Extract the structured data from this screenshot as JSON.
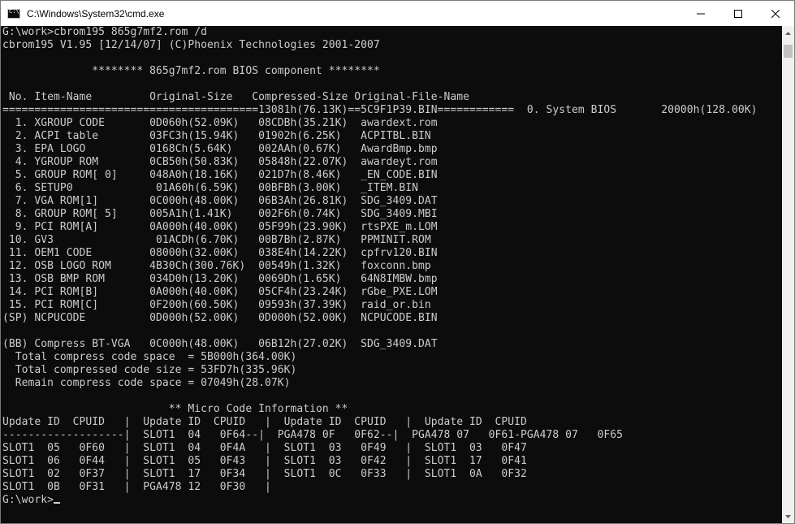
{
  "window": {
    "title": "C:\\Windows\\System32\\cmd.exe",
    "controls": {
      "minimize_icon": "minimize-icon",
      "maximize_icon": "maximize-icon",
      "close_icon": "close-icon"
    },
    "colors": {
      "console_bg": "#0c0c0c",
      "console_fg": "#cccccc",
      "titlebar_bg": "#ffffff"
    }
  },
  "console": {
    "lines": [
      "G:\\work>cbrom195 865g7mf2.rom /d",
      "cbrom195 V1.95 [12/14/07] (C)Phoenix Technologies 2001-2007",
      "",
      "              ******** 865g7mf2.rom BIOS component ********",
      "",
      " No. Item-Name         Original-Size   Compressed-Size Original-File-Name",
      "========================================13081h(76.13K)==5C9F1P39.BIN============  0. System BIOS       20000h(128.00K)",
      "  1. XGROUP CODE       0D060h(52.09K)   08CDBh(35.21K)  awardext.rom",
      "  2. ACPI table        03FC3h(15.94K)   01902h(6.25K)   ACPITBL.BIN",
      "  3. EPA LOGO          0168Ch(5.64K)    002AAh(0.67K)   AwardBmp.bmp",
      "  4. YGROUP ROM        0CB50h(50.83K)   05848h(22.07K)  awardeyt.rom",
      "  5. GROUP ROM[ 0]     048A0h(18.16K)   021D7h(8.46K)   _EN_CODE.BIN",
      "  6. SETUP0             01A60h(6.59K)   00BFBh(3.00K)   _ITEM.BIN",
      "  7. VGA ROM[1]        0C000h(48.00K)   06B3Ah(26.81K)  SDG_3409.DAT",
      "  8. GROUP ROM[ 5]     005A1h(1.41K)    002F6h(0.74K)   SDG_3409.MBI",
      "  9. PCI ROM[A]        0A000h(40.00K)   05F99h(23.90K)  rtsPXE_m.LOM",
      " 10. GV3                01ACDh(6.70K)   00B7Bh(2.87K)   PPMINIT.ROM",
      " 11. OEM1 CODE         08000h(32.00K)   038E4h(14.22K)  cpfrv120.BIN",
      " 12. OSB LOGO ROM      4B30Ch(300.76K)  00549h(1.32K)   foxconn.bmp",
      " 13. OSB BMP ROM       034D0h(13.20K)   0069Dh(1.65K)   64N8IMBW.bmp",
      " 14. PCI ROM[B]        0A000h(40.00K)   05CF4h(23.24K)  rGbe_PXE.LOM",
      " 15. PCI ROM[C]        0F200h(60.50K)   09593h(37.39K)  raid_or.bin",
      "(SP) NCPUCODE          0D000h(52.00K)   0D000h(52.00K)  NCPUCODE.BIN",
      "",
      "(BB) Compress BT-VGA   0C000h(48.00K)   06B12h(27.02K)  SDG_3409.DAT",
      "  Total compress code space  = 5B000h(364.00K)",
      "  Total compressed code size = 53FD7h(335.96K)",
      "  Remain compress code space = 07049h(28.07K)",
      "",
      "                          ** Micro Code Information **",
      "Update ID  CPUID   |  Update ID  CPUID   |  Update ID  CPUID   |  Update ID  CPUID",
      "-------------------|  SLOT1  04   0F64--|  PGA478 0F   0F62--|  PGA478 07   0F61-PGA478 07   0F65",
      "SLOT1  05   0F60   |  SLOT1  04   0F4A   |  SLOT1  03   0F49   |  SLOT1  03   0F47",
      "SLOT1  06   0F44   |  SLOT1  05   0F43   |  SLOT1  03   0F42   |  SLOT1  17   0F41",
      "SLOT1  02   0F37   |  SLOT1  17   0F34   |  SLOT1  0C   0F33   |  SLOT1  0A   0F32",
      "SLOT1  0B   0F31   |  PGA478 12   0F30   |",
      "G:\\work>"
    ]
  },
  "scrollbar": {
    "up_icon": "scroll-up-arrow-icon",
    "down_icon": "scroll-down-arrow-icon"
  }
}
